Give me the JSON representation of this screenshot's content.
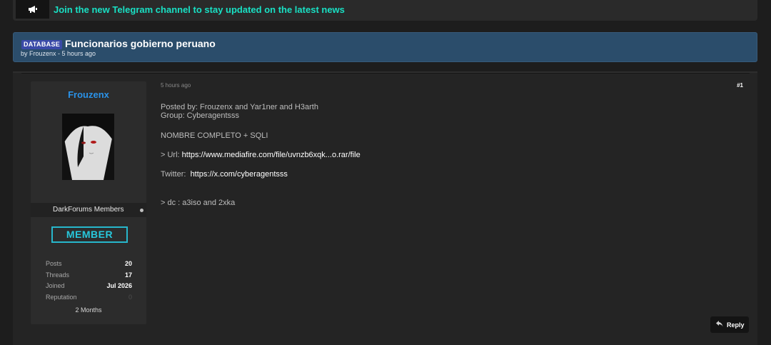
{
  "announcement": {
    "icon": "megaphone-icon",
    "text": "Join the new Telegram channel to stay updated on the latest news"
  },
  "thread": {
    "prefix": "DATABASE",
    "title": "Funcionarios gobierno peruano",
    "meta": "by Frouzenx - 5 hours ago"
  },
  "author": {
    "username": "Frouzenx",
    "usergroup": "DarkForums Members",
    "rank": "MEMBER",
    "stats": [
      {
        "label": "Posts",
        "value": "20"
      },
      {
        "label": "Threads",
        "value": "17"
      },
      {
        "label": "Joined",
        "value": "Jul 2026"
      },
      {
        "label": "Reputation",
        "value": "0"
      }
    ],
    "member_since": "2 Months"
  },
  "post": {
    "date": "5 hours ago",
    "number": "#1",
    "lines": {
      "posted_by": "Posted by: Frouzenx and Yar1ner and H3arth",
      "group": "Group: Cyberagentsss",
      "nombre": "NOMBRE COMPLETO + SQLI",
      "url_prefix": "> Url: ",
      "url_link": "https://www.mediafire.com/file/uvnzb6xqk...o.rar/file",
      "twitter_prefix": "Twitter:  ",
      "twitter_link": "https://x.com/cyberagentsss",
      "dc": "> dc : a3iso and 2xka"
    },
    "reply_label": "Reply"
  },
  "colors": {
    "accent_cyan": "#19e0c4",
    "header_blue": "#2b4d6b",
    "username_blue": "#2a92e8",
    "prefix_bg": "#3a4aa8"
  }
}
